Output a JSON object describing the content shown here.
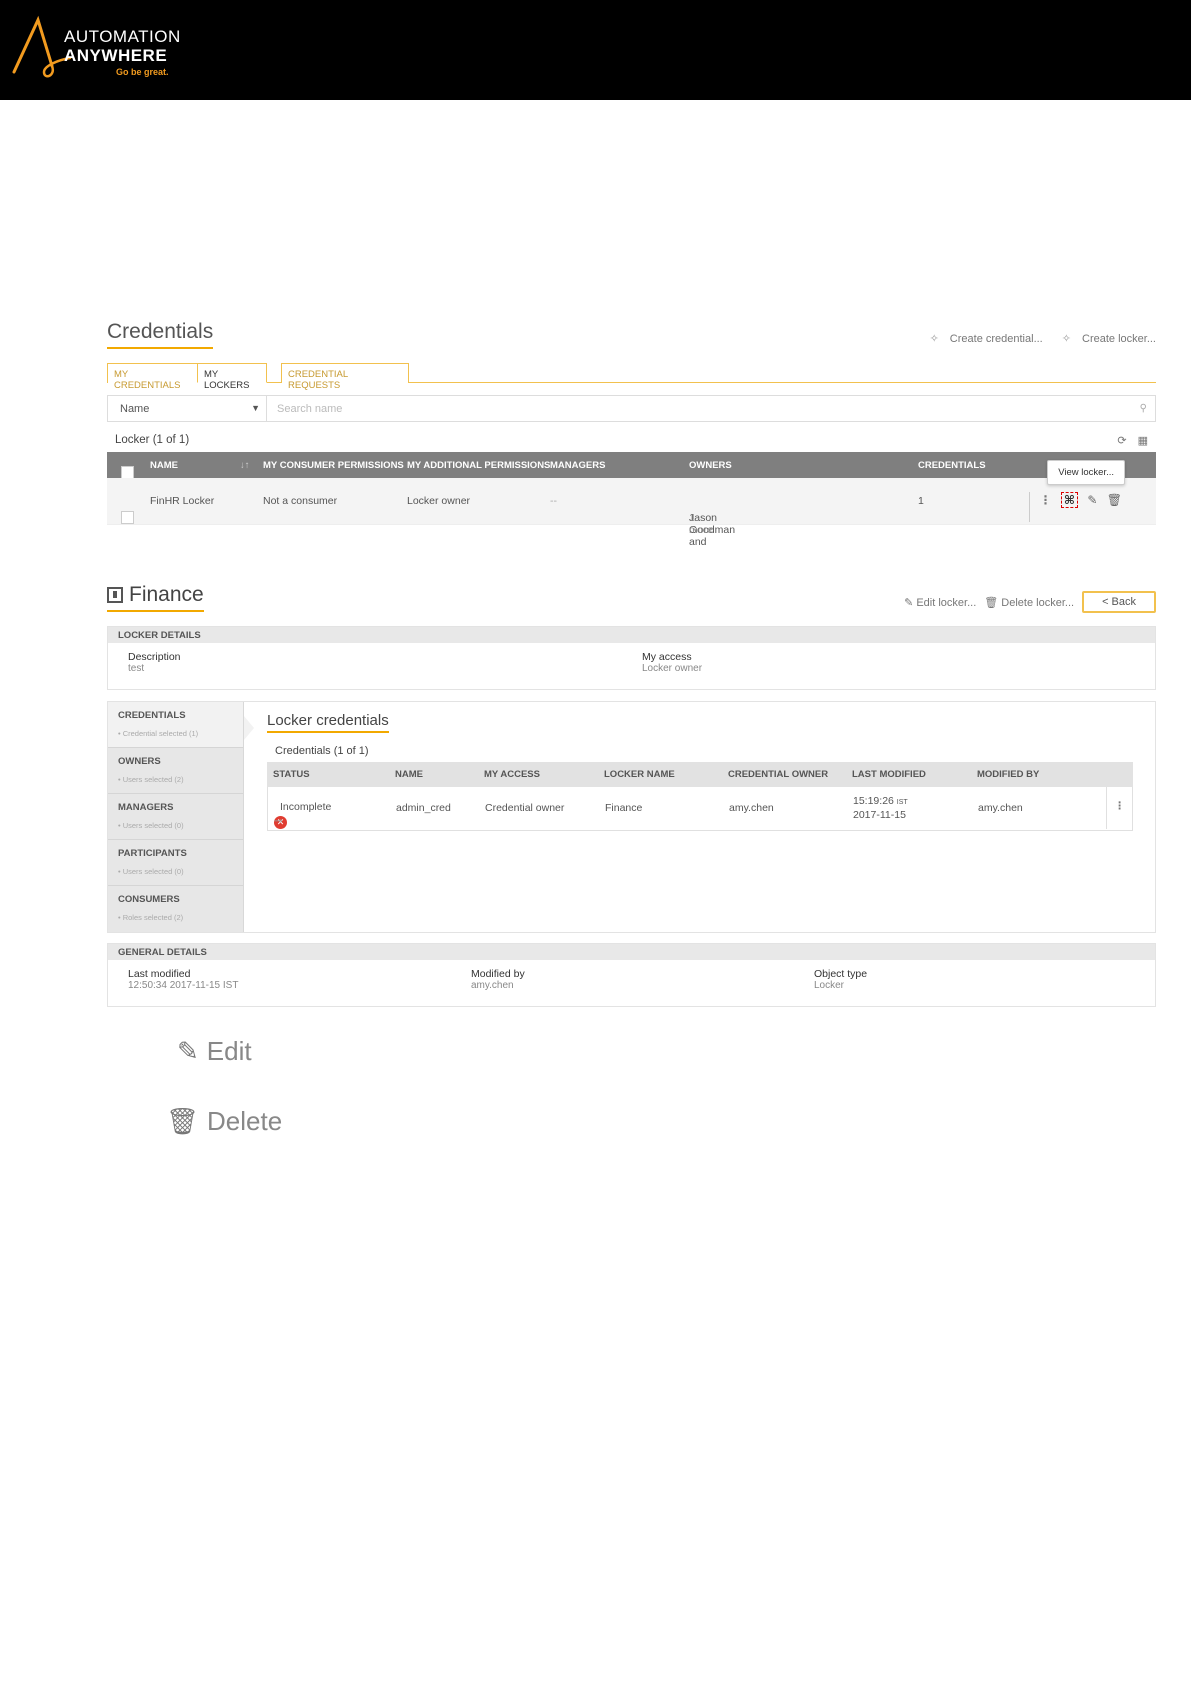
{
  "brand": {
    "line1": "AUTOMATION",
    "line2": "ANYWHERE",
    "tagline": "Go be great.",
    "accent_color": "#f29b1f"
  },
  "credentials_page": {
    "title": "Credentials",
    "create_credential": "Create credential...",
    "create_locker": "Create locker...",
    "tabs": [
      "MY CREDENTIALS",
      "MY LOCKERS",
      "CREDENTIAL REQUESTS"
    ],
    "active_tab": "MY LOCKERS",
    "search": {
      "selected_field": "Name",
      "placeholder": "Search name"
    },
    "locker_count": "Locker (1 of 1)",
    "columns": [
      "NAME",
      "MY CONSUMER PERMISSIONS",
      "MY ADDITIONAL PERMISSIONS",
      "MANAGERS",
      "OWNERS",
      "CREDENTIALS"
    ],
    "row": {
      "name": "FinHR Locker",
      "consumer_permissions": "Not a consumer",
      "additional_permissions": "Locker owner",
      "managers": "--",
      "owners_prefix": "Jason Goodman and",
      "owners_more": "1 more",
      "credentials": "1"
    },
    "tooltip": "View locker..."
  },
  "locker_detail": {
    "title": "Finance",
    "edit_locker": "Edit locker...",
    "delete_locker": "Delete locker...",
    "back": "< Back",
    "locker_details_header": "LOCKER DETAILS",
    "description_label": "Description",
    "description_value": "test",
    "my_access_label": "My access",
    "my_access_value": "Locker owner",
    "side_items": [
      {
        "title": "CREDENTIALS",
        "sub": "• Credential selected (1)"
      },
      {
        "title": "OWNERS",
        "sub": "• Users selected (2)"
      },
      {
        "title": "MANAGERS",
        "sub": "• Users selected (0)"
      },
      {
        "title": "PARTICIPANTS",
        "sub": "• Users selected (0)"
      },
      {
        "title": "CONSUMERS",
        "sub": "• Roles selected (2)"
      }
    ],
    "locker_credentials_title": "Locker credentials",
    "credentials_count": "Credentials (1 of 1)",
    "cred_columns": [
      "STATUS",
      "NAME",
      "MY ACCESS",
      "LOCKER NAME",
      "CREDENTIAL OWNER",
      "LAST MODIFIED",
      "MODIFIED BY"
    ],
    "cred_row": {
      "status": "Incomplete",
      "name": "admin_cred",
      "my_access": "Credential owner",
      "locker_name": "Finance",
      "owner": "amy.chen",
      "last_modified_time": "15:19:26",
      "last_modified_tz": "IST",
      "last_modified_date": "2017-11-15",
      "modified_by": "amy.chen"
    },
    "general_details_header": "GENERAL DETAILS",
    "last_modified_label": "Last modified",
    "last_modified_value": "12:50:34 2017-11-15 IST",
    "modified_by_label": "Modified by",
    "modified_by_value": "amy.chen",
    "object_type_label": "Object type",
    "object_type_value": "Locker"
  },
  "legend": {
    "edit": "Edit",
    "delete": "Delete"
  }
}
